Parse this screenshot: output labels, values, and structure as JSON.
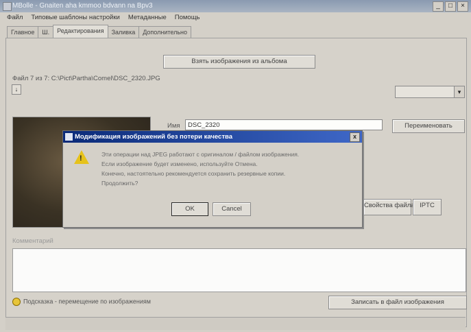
{
  "window": {
    "title": "MBolle - Gnaiten aha kmmoo bdvann na Bpv3",
    "controls": [
      "_",
      "□",
      "×"
    ]
  },
  "menu": [
    "Файл",
    "Типовые шаблоны настройки",
    "Метаданные",
    "Помощь"
  ],
  "tabs": [
    "Главное",
    "Ш.",
    "Редактирования",
    "Заливка",
    "Дополнительно"
  ],
  "toolbar": {
    "album_button": "Взять изображения из альбома"
  },
  "file": {
    "path_label": "Файл 7 из 7: C:\\Pict\\Partha\\Comel\\DSC_2320.JPG",
    "nav_button": "↓"
  },
  "name_field": {
    "label": "Имя",
    "value": "DSC_2320"
  },
  "buttons": {
    "rename": "Переименовать",
    "file_props": "Свойства файла",
    "iptc": "IPTC",
    "save_image": "Записать в файл изображения"
  },
  "comment_label": "Комментарий",
  "hint": "Подсказка - перемещение по изображениям",
  "dialog": {
    "title": "Модификация изображений без потери качества",
    "message_lines": [
      "Эти операции над JPEG работают с оригиналом / файлом изображения.",
      "Если изображение будет изменено, используйте Отмена.",
      "Конечно, настоятельно рекомендуется сохранить резервные копии.",
      "Продолжить?"
    ],
    "ok": "OK",
    "cancel": "Cancel"
  },
  "colors": {
    "dialog_title_start": "#0a2a78",
    "dialog_title_end": "#3f68c8",
    "warning": "#e6c21b"
  }
}
